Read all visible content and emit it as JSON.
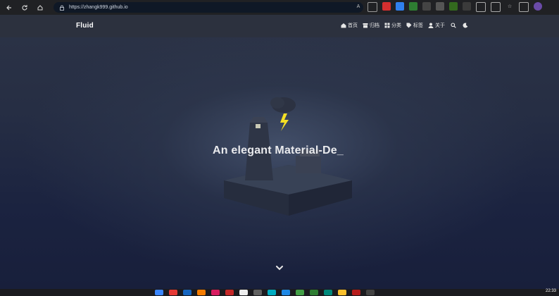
{
  "browser": {
    "url": "https://zhangk999.github.io"
  },
  "site": {
    "brand": "Fluid",
    "menu": [
      {
        "label": "首页",
        "icon": "home-icon"
      },
      {
        "label": "归档",
        "icon": "archive-icon"
      },
      {
        "label": "分类",
        "icon": "grid-icon"
      },
      {
        "label": "标签",
        "icon": "tag-icon"
      },
      {
        "label": "关于",
        "icon": "user-icon"
      }
    ],
    "hero_title": "An elegant Material-De_"
  },
  "taskbar": {
    "time": "22:33"
  },
  "colors": {
    "browser_bg": "#202124",
    "nav_bg": "#2c313e",
    "accent_lightning": "#f5e024"
  }
}
